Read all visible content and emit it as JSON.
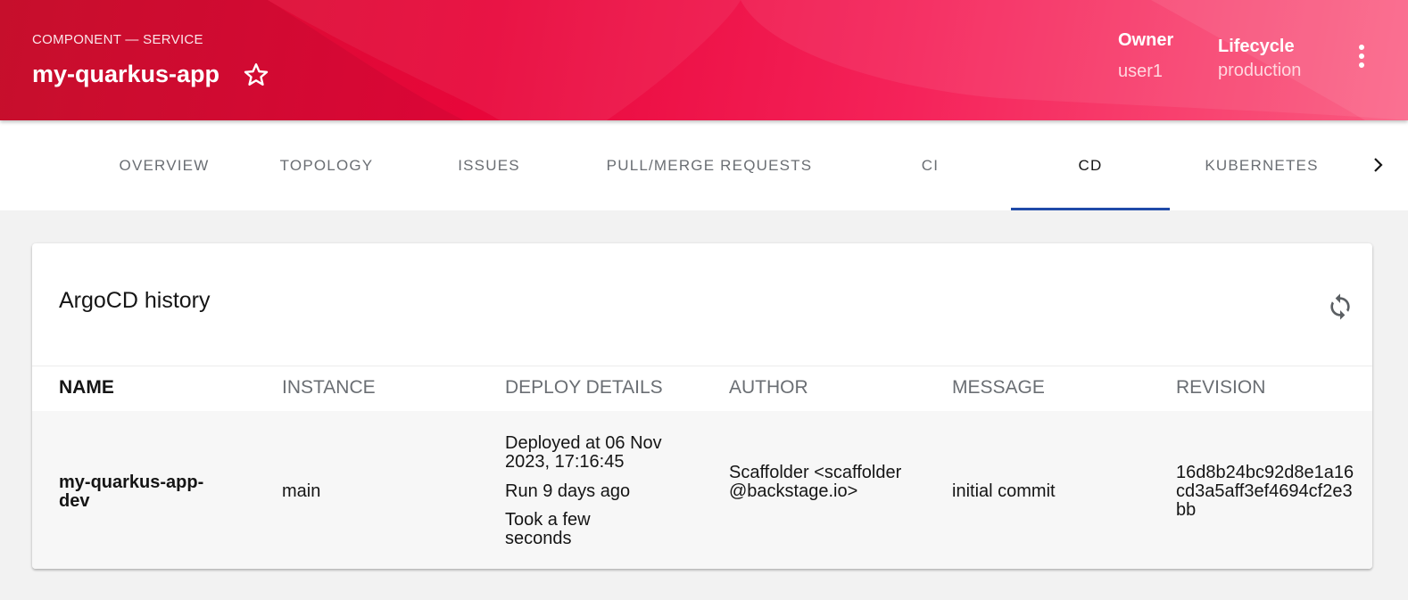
{
  "header": {
    "kind": "COMPONENT — SERVICE",
    "title": "my-quarkus-app",
    "owner_label": "Owner",
    "owner_value": "user1",
    "lifecycle_label": "Lifecycle",
    "lifecycle_value": "production",
    "colors": {
      "gradient_start": "#d1102f",
      "gradient_end": "#fa5a80"
    }
  },
  "tabs": [
    {
      "label": "OVERVIEW"
    },
    {
      "label": "TOPOLOGY"
    },
    {
      "label": "ISSUES"
    },
    {
      "label": "PULL/MERGE REQUESTS"
    },
    {
      "label": "CI"
    },
    {
      "label": "CD",
      "active": true
    },
    {
      "label": "KUBERNETES"
    }
  ],
  "card": {
    "title": "ArgoCD history",
    "columns": [
      "NAME",
      "INSTANCE",
      "DEPLOY DETAILS",
      "AUTHOR",
      "MESSAGE",
      "REVISION"
    ],
    "rows": [
      {
        "name": "my-quarkus-app-dev",
        "instance": "main",
        "deployed_at": "Deployed at 06 Nov 2023, 17:16:45",
        "run": "Run 9 days ago",
        "took": "Took a few seconds",
        "author": "Scaffolder <scaffolder@backstage.io>",
        "message": "initial commit",
        "revision": "16d8b24bc92d8e1a16cd3a5aff3ef4694cf2e3bb"
      }
    ]
  },
  "icons": {
    "favorite": "star-outline-icon",
    "menu": "more-vertical-icon",
    "tab_scroll": "chevron-right-icon",
    "refresh": "refresh-icon"
  },
  "accent_color": "#1f4aa8"
}
